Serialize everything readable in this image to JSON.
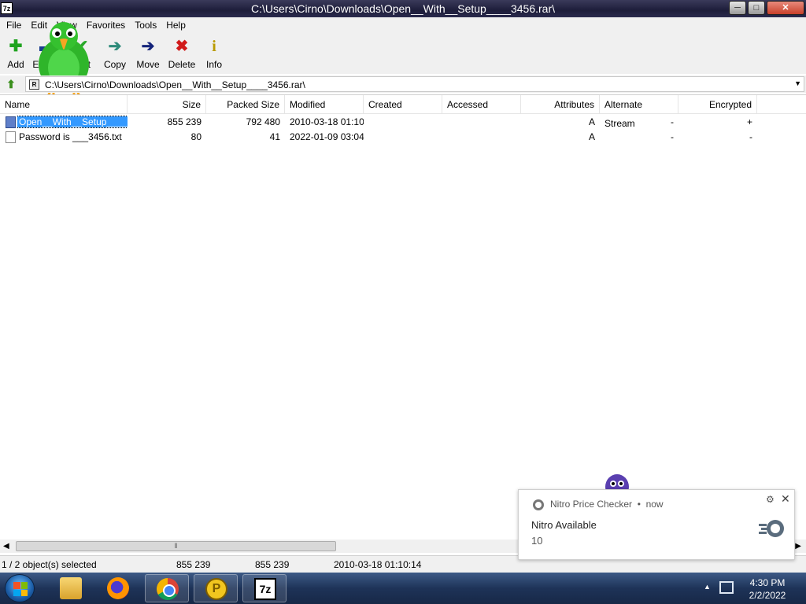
{
  "window": {
    "app_icon": "7z",
    "title": "C:\\Users\\Cirno\\Downloads\\Open__With__Setup____3456.rar\\",
    "controls": [
      "minimize-icon",
      "maximize-icon",
      "close-icon"
    ]
  },
  "menu": [
    "File",
    "Edit",
    "View",
    "Favorites",
    "Tools",
    "Help"
  ],
  "toolbar": {
    "add": "Add",
    "extract": "Extract",
    "test": "Test",
    "copy": "Copy",
    "move": "Move",
    "delete": "Delete",
    "info": "Info"
  },
  "address": {
    "path": "C:\\Users\\Cirno\\Downloads\\Open__With__Setup____3456.rar\\"
  },
  "columns": [
    "Name",
    "Size",
    "Packed Size",
    "Modified",
    "Created",
    "Accessed",
    "Attributes",
    "Alternate Stream",
    "Encrypted"
  ],
  "files": [
    {
      "name": "Open__With__Setup____...",
      "size": "855 239",
      "packed": "792 480",
      "modified": "2010-03-18 01:10",
      "created": "",
      "accessed": "",
      "attributes": "A",
      "alt_stream": "-",
      "encrypted": "+"
    },
    {
      "name": "Password is ___3456.txt",
      "size": "80",
      "packed": "41",
      "modified": "2022-01-09 03:04",
      "created": "",
      "accessed": "",
      "attributes": "A",
      "alt_stream": "-",
      "encrypted": "-"
    }
  ],
  "status": {
    "selection": "1 / 2 object(s) selected",
    "size": "855 239",
    "packed": "855 239",
    "modified": "2010-03-18 01:10:14"
  },
  "notification": {
    "source": "Nitro Price Checker",
    "time": "now",
    "title": "Nitro Available",
    "body": "10"
  },
  "taskbar": {
    "apps": [
      "folder-icon",
      "firefox-icon",
      "chrome-icon",
      "p-icon",
      "7z-icon"
    ],
    "p_label": "P",
    "sevenz_label": "7z",
    "time": "4:30 PM",
    "date": "2/2/2022"
  }
}
